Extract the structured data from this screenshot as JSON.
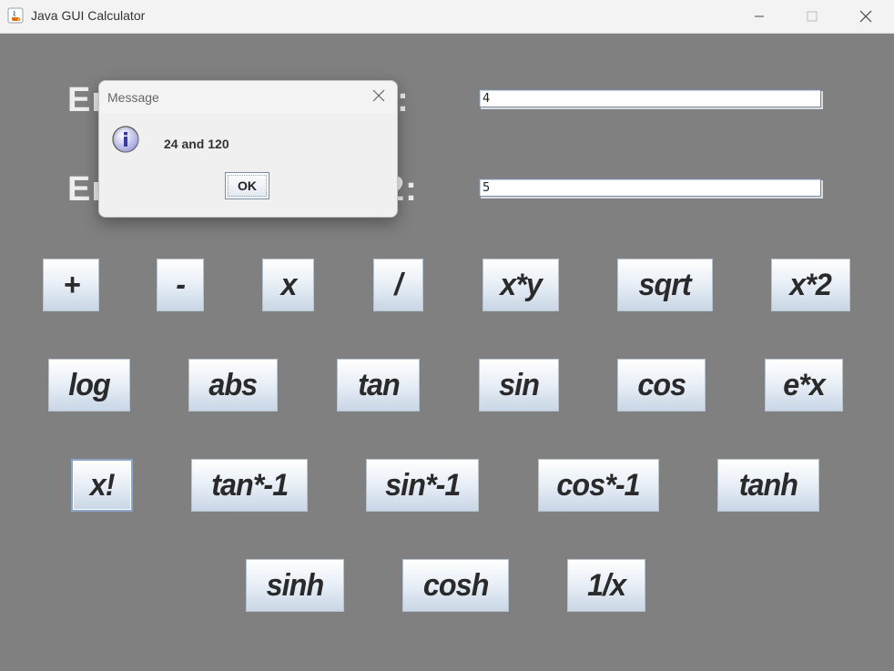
{
  "window": {
    "title": "Java GUI Calculator",
    "minimize_label": "minimize",
    "maximize_label": "maximize",
    "close_label": "close"
  },
  "form": {
    "label1": "Enter number 1:",
    "label2": "Enter number 2:",
    "label1_visible_prefix": "Er",
    "label1_visible_suffix": ":",
    "label2_visible_prefix": "Er",
    "label2_visible_suffix": "2:",
    "input1_value": "4",
    "input2_value": "5"
  },
  "buttons": {
    "row1": [
      "+",
      "-",
      "x",
      "/",
      "x*y",
      "sqrt",
      "x*2"
    ],
    "row2": [
      "log",
      "abs",
      "tan",
      "sin",
      "cos",
      "e*x"
    ],
    "row3": [
      "x!",
      "tan*-1",
      "sin*-1",
      "cos*-1",
      "tanh"
    ],
    "row4": [
      "sinh",
      "cosh",
      "1/x"
    ]
  },
  "dialog": {
    "title": "Message",
    "message": "24 and 120",
    "ok_label": "OK",
    "icon": "info-icon"
  },
  "colors": {
    "background": "#808080",
    "label_text": "#eeeeee",
    "button_gradient_top": "#ffffff",
    "button_gradient_bottom": "#c9d6e6"
  }
}
